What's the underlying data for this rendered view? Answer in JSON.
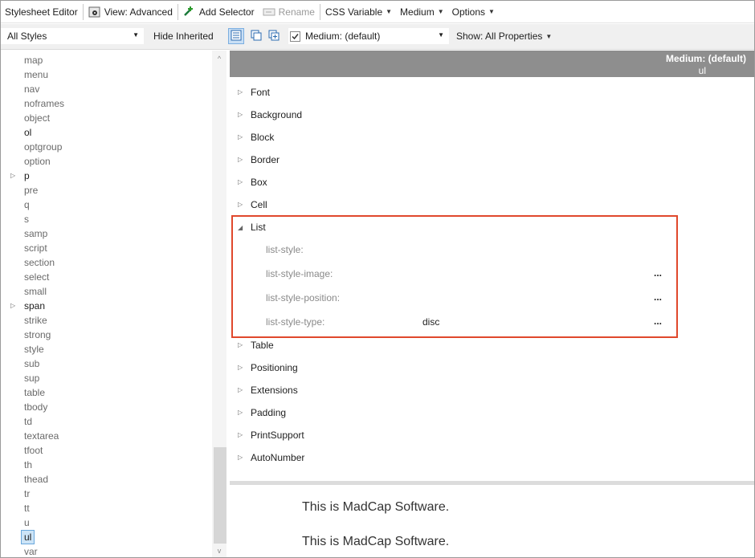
{
  "toolbar": {
    "title": "Stylesheet Editor",
    "view": "View: Advanced",
    "add_selector": "Add Selector",
    "rename": "Rename",
    "css_variable": "CSS Variable",
    "medium": "Medium",
    "options": "Options"
  },
  "filter_bar": {
    "styles_combo": "All Styles",
    "hide_inherited": "Hide Inherited",
    "medium_checkbox": "Medium: (default)",
    "show_properties": "Show: All Properties"
  },
  "selectors": [
    {
      "label": "map",
      "dark": false,
      "expander": false
    },
    {
      "label": "menu",
      "dark": false,
      "expander": false
    },
    {
      "label": "nav",
      "dark": false,
      "expander": false
    },
    {
      "label": "noframes",
      "dark": false,
      "expander": false
    },
    {
      "label": "object",
      "dark": false,
      "expander": false
    },
    {
      "label": "ol",
      "dark": true,
      "expander": false
    },
    {
      "label": "optgroup",
      "dark": false,
      "expander": false
    },
    {
      "label": "option",
      "dark": false,
      "expander": false
    },
    {
      "label": "p",
      "dark": true,
      "expander": true
    },
    {
      "label": "pre",
      "dark": false,
      "expander": false
    },
    {
      "label": "q",
      "dark": false,
      "expander": false
    },
    {
      "label": "s",
      "dark": false,
      "expander": false
    },
    {
      "label": "samp",
      "dark": false,
      "expander": false
    },
    {
      "label": "script",
      "dark": false,
      "expander": false
    },
    {
      "label": "section",
      "dark": false,
      "expander": false
    },
    {
      "label": "select",
      "dark": false,
      "expander": false
    },
    {
      "label": "small",
      "dark": false,
      "expander": false
    },
    {
      "label": "span",
      "dark": true,
      "expander": true
    },
    {
      "label": "strike",
      "dark": false,
      "expander": false
    },
    {
      "label": "strong",
      "dark": false,
      "expander": false
    },
    {
      "label": "style",
      "dark": false,
      "expander": false
    },
    {
      "label": "sub",
      "dark": false,
      "expander": false
    },
    {
      "label": "sup",
      "dark": false,
      "expander": false
    },
    {
      "label": "table",
      "dark": false,
      "expander": false
    },
    {
      "label": "tbody",
      "dark": false,
      "expander": false
    },
    {
      "label": "td",
      "dark": false,
      "expander": false
    },
    {
      "label": "textarea",
      "dark": false,
      "expander": false
    },
    {
      "label": "tfoot",
      "dark": false,
      "expander": false
    },
    {
      "label": "th",
      "dark": false,
      "expander": false
    },
    {
      "label": "thead",
      "dark": false,
      "expander": false
    },
    {
      "label": "tr",
      "dark": false,
      "expander": false
    },
    {
      "label": "tt",
      "dark": false,
      "expander": false
    },
    {
      "label": "u",
      "dark": false,
      "expander": false
    },
    {
      "label": "ul",
      "dark": true,
      "expander": false,
      "selected": true
    },
    {
      "label": "var",
      "dark": false,
      "expander": false
    }
  ],
  "properties_header": {
    "medium": "Medium: (default)",
    "selector": "ul"
  },
  "categories_before": [
    "Font",
    "Background",
    "Block",
    "Border",
    "Box",
    "Cell"
  ],
  "list_category": {
    "label": "List",
    "properties": [
      {
        "name": "list-style:",
        "value": "",
        "has_button": false
      },
      {
        "name": "list-style-image:",
        "value": "",
        "has_button": true
      },
      {
        "name": "list-style-position:",
        "value": "",
        "has_button": true
      },
      {
        "name": "list-style-type:",
        "value": "disc",
        "has_button": true
      }
    ]
  },
  "categories_after": [
    "Table",
    "Positioning",
    "Extensions",
    "Padding",
    "PrintSupport",
    "AutoNumber"
  ],
  "ellipsis": "...",
  "preview": [
    "This is MadCap Software.",
    "This is MadCap Software."
  ],
  "colors": {
    "highlight_border": "#e0482c",
    "header_bg": "#8e8e8e",
    "selection_bg": "#cce4f7"
  }
}
